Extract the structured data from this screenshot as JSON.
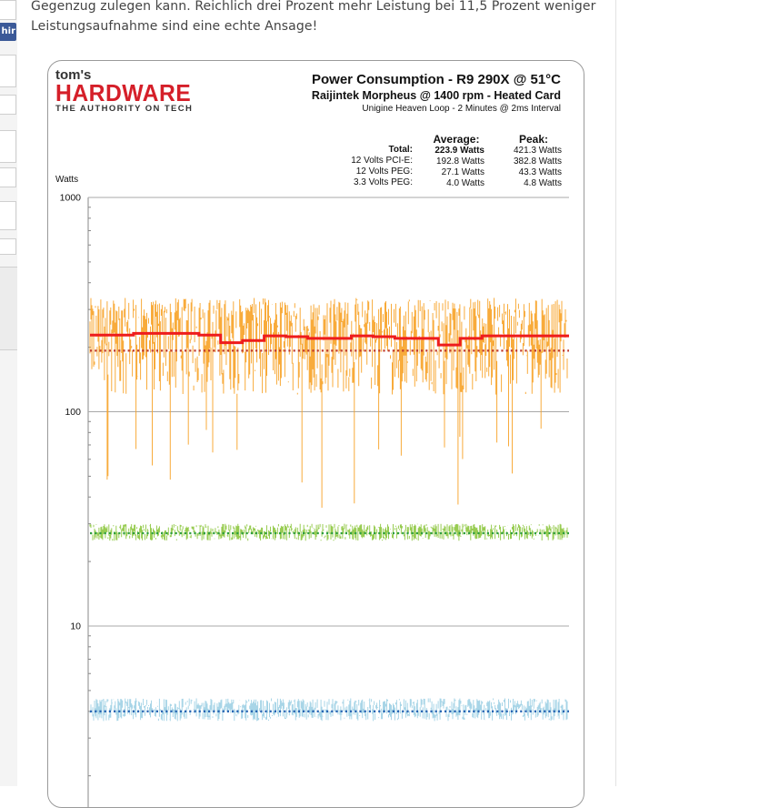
{
  "sidebar": {
    "share_button_label": "hir"
  },
  "article": {
    "line1": "Gegenzug zulegen kann. Reichlich drei Prozent mehr Leistung bei 11,5 Prozent weniger",
    "line2": "Leistungsaufnahme sind eine echte Ansage!"
  },
  "logo": {
    "top": "tom's",
    "main": "HARDWARE",
    "tagline": "THE AUTHORITY ON TECH"
  },
  "chart_header": {
    "title": "Power Consumption - R9 290X @ 51°C",
    "subtitle": "Raijintek Morpheus @ 1400 rpm - Heated Card",
    "note": "Unigine Heaven Loop - 2 Minutes @ 2ms Interval"
  },
  "stats": {
    "average_header": "Average:",
    "peak_header": "Peak:",
    "rows": [
      {
        "label": "Total:",
        "average": "223.9 Watts",
        "peak": "421.3 Watts"
      },
      {
        "label": "12 Volts PCI-E:",
        "average": "192.8 Watts",
        "peak": "382.8 Watts"
      },
      {
        "label": "12 Volts PEG:",
        "average": "27.1 Watts",
        "peak": "43.3 Watts"
      },
      {
        "label": "3.3 Volts PEG:",
        "average": "4.0 Watts",
        "peak": "4.8 Watts"
      }
    ]
  },
  "chart_data": {
    "type": "line",
    "title": "Power Consumption - R9 290X @ 51°C",
    "ylabel": "Watts",
    "yscale": "log",
    "ylim": [
      1,
      1000
    ],
    "yticks": [
      "1000",
      "100",
      "10"
    ],
    "grid": true,
    "series": [
      {
        "name": "Total:",
        "color": "#ee1c1c",
        "average": 223.9,
        "peak": 421.3,
        "style": "average-step-line"
      },
      {
        "name": "12 Volts PCI-E:",
        "color": "#f7a226",
        "average": 192.8,
        "peak": 382.8,
        "typical_range": [
          120,
          340
        ],
        "dips_to": 35,
        "style": "dense-noisy"
      },
      {
        "name": "12 Volts PEG:",
        "color": "#8dc63f",
        "average": 27.1,
        "peak": 43.3,
        "typical_range": [
          25,
          30
        ],
        "style": "dense-noisy"
      },
      {
        "name": "3.3 Volts PEG:",
        "color": "#9fd0e4",
        "average": 4.0,
        "peak": 4.8,
        "typical_range": [
          3.6,
          4.6
        ],
        "style": "dense-noisy"
      }
    ],
    "average_lines": [
      {
        "series": "12 Volts PCI-E:",
        "value": 192.8,
        "color": "#c0392b",
        "style": "dotted"
      },
      {
        "series": "12 Volts PEG:",
        "value": 27.1,
        "color": "#2e9e3e",
        "style": "dotted"
      },
      {
        "series": "3.3 Volts PEG:",
        "value": 4.0,
        "color": "#1f5fb0",
        "style": "dotted"
      }
    ],
    "total_steps": [
      228,
      228,
      232,
      232,
      232,
      228,
      210,
      215,
      226,
      224,
      220,
      220,
      226,
      224,
      220,
      220,
      205,
      220,
      226,
      226,
      226,
      226
    ]
  },
  "colors": {
    "brand_red": "#d51f29",
    "frame_border": "#9a9a9a"
  }
}
